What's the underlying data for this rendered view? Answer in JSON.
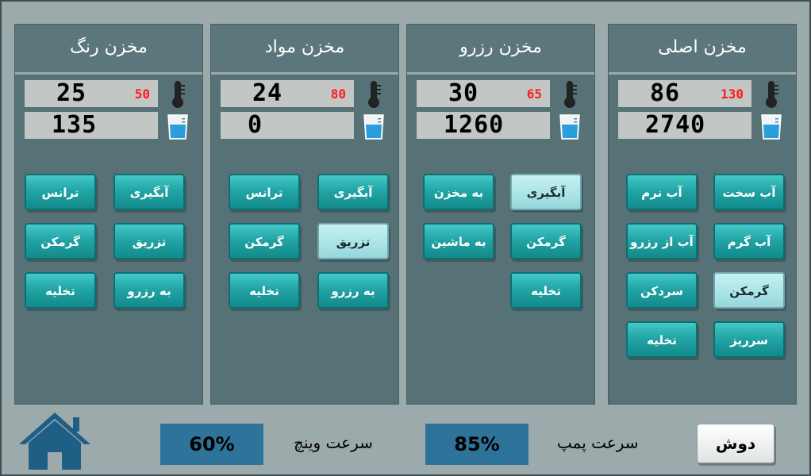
{
  "tanks": [
    {
      "title": "مخزن رنگ",
      "temp": "25",
      "setpoint": "50",
      "level": "135",
      "buttons": [
        "ترانس",
        "آبگیری",
        "گرمکن",
        "تزریق",
        "تخلیه",
        "به رزرو"
      ]
    },
    {
      "title": "مخزن مواد",
      "temp": "24",
      "setpoint": "80",
      "level": "0",
      "buttons": [
        "ترانس",
        "آبگیری",
        "گرمکن",
        "تزریق",
        "تخلیه",
        "به رزرو"
      ]
    },
    {
      "title": "مخزن رزرو",
      "temp": "30",
      "setpoint": "65",
      "level": "1260",
      "buttons": [
        "به مخزن",
        "آبگیری",
        "به ماشین",
        "گرمکن",
        "تخلیه"
      ]
    },
    {
      "title": "مخزن اصلی",
      "temp": "86",
      "setpoint": "130",
      "level": "2740",
      "buttons": [
        "آب نرم",
        "آب سخت",
        "آب از رزرو",
        "آب گرم",
        "سردکن",
        "گرمکن",
        "تخلیه",
        "سرریز"
      ]
    }
  ],
  "bottom": {
    "winch_label": "سرعت وینچ",
    "winch_value": "60%",
    "pump_label": "سرعت پمپ",
    "pump_value": "85%",
    "dush_label": "دوش"
  },
  "colors": {
    "panel": "#577276",
    "button": "#22a5a6",
    "button_active": "#a8e3e7",
    "value_box": "#2e7399",
    "setpoint": "#ff1a1a"
  },
  "icons": {
    "home": "home-icon",
    "thermometer": "thermometer-icon",
    "beaker": "beaker-icon"
  }
}
